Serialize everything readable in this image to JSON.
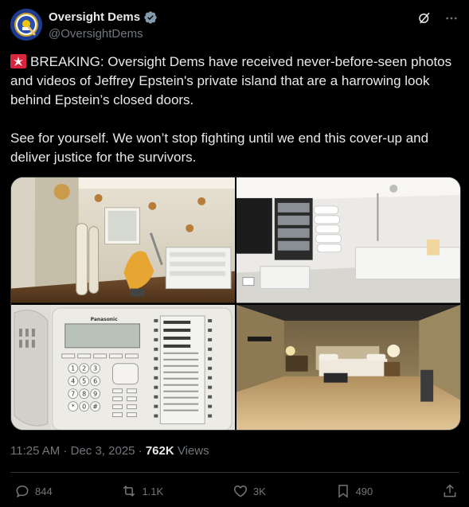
{
  "account": {
    "display_name": "Oversight Dems",
    "handle": "@OversightDems",
    "verified_icon": "verified-badge-icon",
    "avatar": "oversight-dems-seal"
  },
  "header_icons": [
    "grok-icon",
    "more-icon"
  ],
  "post": {
    "siren_icon": "rotating-light-emoji",
    "paragraph1": "BREAKING: Oversight Dems have received never-before-seen photos and videos of Jeffrey Epstein's private island that are a harrowing look behind Epstein’s closed doors.",
    "paragraph2": "See for yourself. We won’t stop fighting until we end this cover-up and deliver justice for the survivors."
  },
  "media": {
    "images": [
      "dental-room-photo",
      "bathroom-shower-photo",
      "desk-phone-photo",
      "bedroom-photo"
    ],
    "phone_brand": "Panasonic",
    "phone_keys": [
      "1",
      "2",
      "3",
      "4",
      "5",
      "6",
      "7",
      "8",
      "9",
      "*",
      "0",
      "#"
    ]
  },
  "meta": {
    "time": "11:25 AM",
    "separator1": " · ",
    "date": "Dec 3, 2025",
    "separator2": " · ",
    "views_count": "762K",
    "views_label": " Views"
  },
  "actions": {
    "replies": "844",
    "reposts": "1.1K",
    "likes": "3K",
    "bookmarks": "490"
  },
  "colors": {
    "background": "#000000",
    "text": "#e7e9ea",
    "muted": "#71767b",
    "border": "#2f3336",
    "verified": "#829aab"
  }
}
